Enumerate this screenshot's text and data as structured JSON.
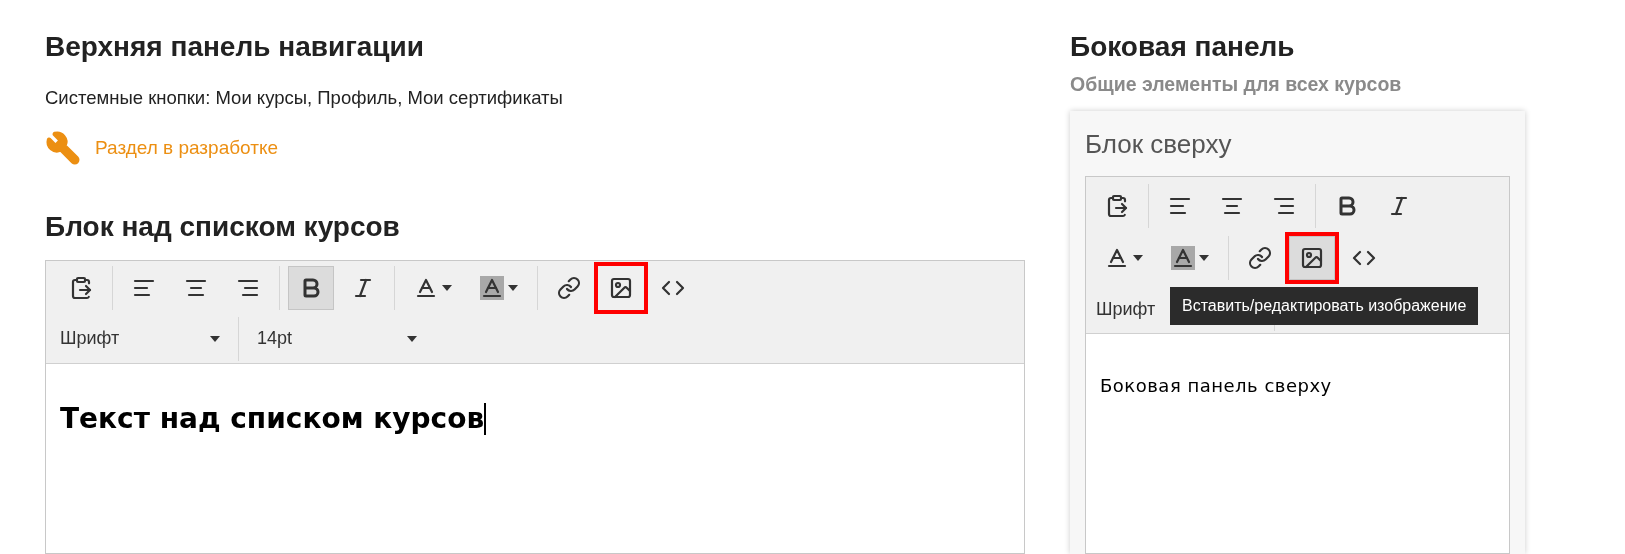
{
  "top_nav": {
    "title": "Верхняя панель навигации",
    "description": "Системные кнопки: Мои курсы, Профиль, Мои сертификаты",
    "notice": "Раздел в разработке"
  },
  "courses_block": {
    "title": "Блок над списком курсов",
    "editor": {
      "toolbar": [
        [
          {
            "kind": "paste",
            "pressed": false,
            "highlighted": false
          }
        ],
        [
          {
            "kind": "align-left",
            "pressed": false,
            "highlighted": false
          },
          {
            "kind": "align-center",
            "pressed": false,
            "highlighted": false
          },
          {
            "kind": "align-right",
            "pressed": false,
            "highlighted": false
          }
        ],
        [
          {
            "kind": "bold",
            "pressed": true,
            "highlighted": false
          },
          {
            "kind": "italic",
            "pressed": false,
            "highlighted": false
          }
        ],
        [
          {
            "kind": "text-color",
            "pressed": false,
            "highlighted": false
          },
          {
            "kind": "background-color",
            "pressed": false,
            "highlighted": false
          }
        ],
        [
          {
            "kind": "link",
            "pressed": false,
            "highlighted": false
          },
          {
            "kind": "image",
            "pressed": false,
            "highlighted": true
          },
          {
            "kind": "code",
            "pressed": false,
            "highlighted": false
          }
        ]
      ],
      "font": "Шрифт",
      "size": "14pt",
      "content": "Текст над списком курсов",
      "kind": "heading"
    }
  },
  "sidebar": {
    "title": "Боковая панель",
    "subtitle": "Общие элементы для всех курсов",
    "card_title": "Блок сверху",
    "editor": {
      "toolbar": [
        [
          {
            "kind": "paste",
            "pressed": false,
            "highlighted": false
          }
        ],
        [
          {
            "kind": "align-left",
            "pressed": false,
            "highlighted": false
          },
          {
            "kind": "align-center",
            "pressed": false,
            "highlighted": false
          },
          {
            "kind": "align-right",
            "pressed": false,
            "highlighted": false
          }
        ],
        [
          {
            "kind": "bold",
            "pressed": false,
            "highlighted": false
          },
          {
            "kind": "italic",
            "pressed": false,
            "highlighted": false
          }
        ],
        [
          {
            "kind": "text-color",
            "pressed": false,
            "highlighted": false
          },
          {
            "kind": "background-color",
            "pressed": false,
            "highlighted": false
          }
        ],
        [
          {
            "kind": "link",
            "pressed": false,
            "highlighted": false
          },
          {
            "kind": "image",
            "pressed": true,
            "highlighted": true
          },
          {
            "kind": "code",
            "pressed": false,
            "highlighted": false
          }
        ]
      ],
      "font": "Шрифт",
      "tooltip": "Вставить/редактировать изображение",
      "content": "Боковая панель сверху",
      "kind": "plain"
    }
  }
}
